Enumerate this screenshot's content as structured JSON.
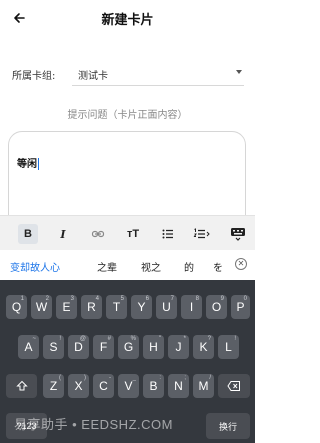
{
  "header": {
    "title": "新建卡片",
    "back_icon": "arrow-left-icon"
  },
  "group": {
    "label": "所属卡组:",
    "value": "测试卡"
  },
  "prompt_hint": "提示问题（卡片正面内容）",
  "editor": {
    "text": "等闲"
  },
  "toolbar": {
    "items": [
      {
        "label": "B",
        "icon": "bold-icon"
      },
      {
        "label": "I",
        "icon": "italic-icon"
      },
      {
        "label": "",
        "icon": "link-icon"
      },
      {
        "label": "тT",
        "icon": "text-size-icon"
      },
      {
        "label": "",
        "icon": "bullet-list-icon"
      },
      {
        "label": "",
        "icon": "numbered-list-icon"
      },
      {
        "label": "",
        "icon": "keyboard-hide-icon"
      }
    ]
  },
  "keyboard": {
    "suggestions": [
      "变却故人心",
      "之辈",
      "视之",
      "的",
      "を"
    ],
    "rows": {
      "row1": [
        {
          "main": "Q",
          "hint": "1"
        },
        {
          "main": "W",
          "hint": "2"
        },
        {
          "main": "E",
          "hint": "3"
        },
        {
          "main": "R",
          "hint": "4"
        },
        {
          "main": "T",
          "hint": "5"
        },
        {
          "main": "Y",
          "hint": "6"
        },
        {
          "main": "U",
          "hint": "7"
        },
        {
          "main": "I",
          "hint": "8"
        },
        {
          "main": "O",
          "hint": "9"
        },
        {
          "main": "P",
          "hint": "0"
        }
      ],
      "row2": [
        {
          "main": "A",
          "hint": "~"
        },
        {
          "main": "S",
          "hint": "!"
        },
        {
          "main": "D",
          "hint": "@"
        },
        {
          "main": "F",
          "hint": "#"
        },
        {
          "main": "G",
          "hint": "%"
        },
        {
          "main": "H",
          "hint": "\""
        },
        {
          "main": "J",
          "hint": "*"
        },
        {
          "main": "K",
          "hint": "?"
        },
        {
          "main": "L",
          "hint": "!"
        }
      ],
      "row3": [
        {
          "main": "Z",
          "hint": "("
        },
        {
          "main": "X",
          "hint": ")"
        },
        {
          "main": "C",
          "hint": "-"
        },
        {
          "main": "V",
          "hint": "_"
        },
        {
          "main": "B",
          "hint": ":"
        },
        {
          "main": "N",
          "hint": ";"
        },
        {
          "main": "M",
          "hint": "/"
        }
      ]
    },
    "bottom_left": "?123",
    "bottom_right": "换行"
  },
  "watermark": "易享助手 • EEDSHZ.COM",
  "colors": {
    "accent": "#1a73e8",
    "keyboard_bg": "#34383e",
    "key_bg": "#5b5f66"
  }
}
